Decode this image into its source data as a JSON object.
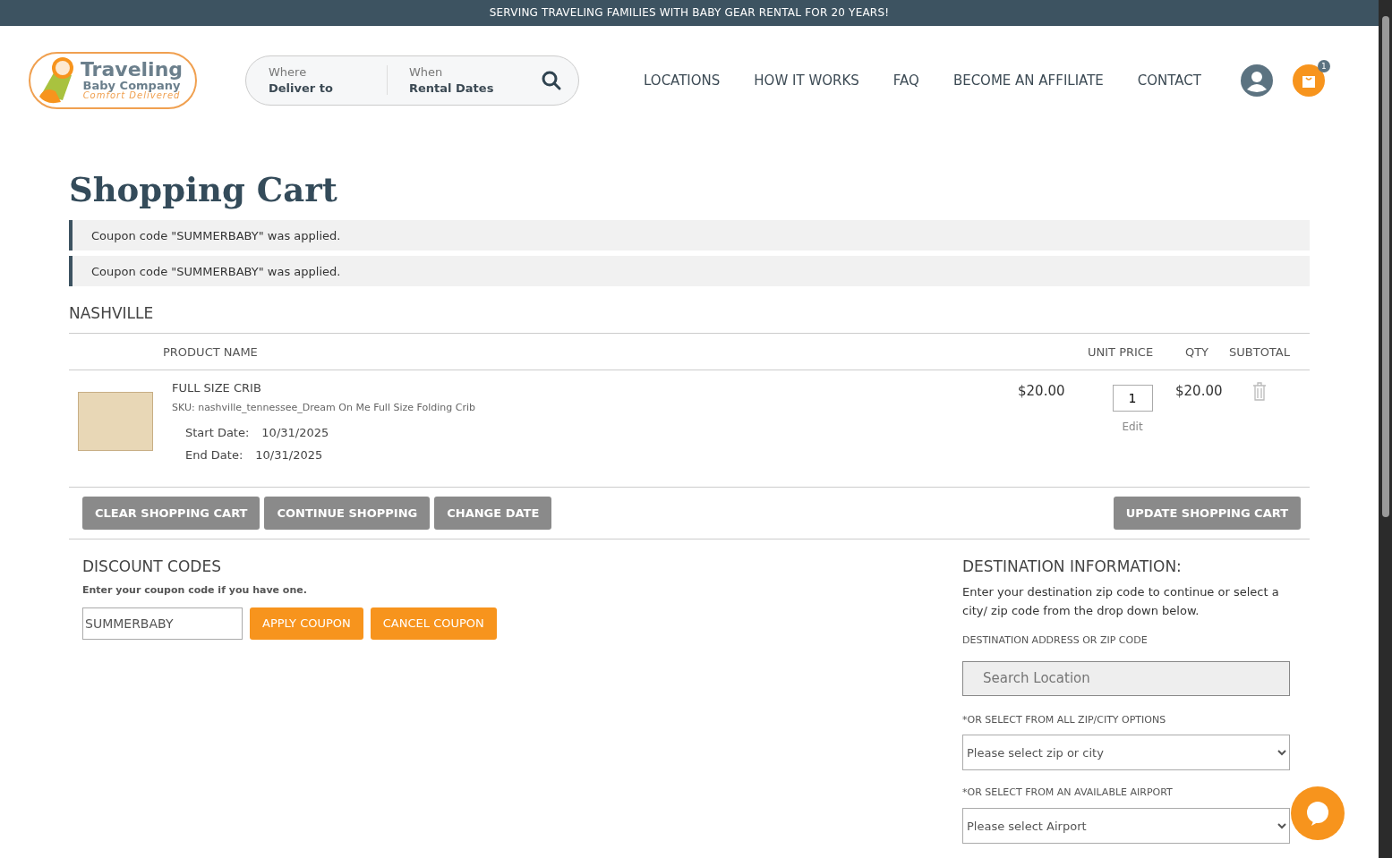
{
  "banner": "SERVING TRAVELING FAMILIES WITH BABY GEAR RENTAL FOR 20 YEARS!",
  "logo": {
    "title": "Traveling",
    "subtitle": "Baby Company",
    "tagline": "Comfort Delivered"
  },
  "search": [
    {
      "label": "Where",
      "value": "Deliver to"
    },
    {
      "label": "When",
      "value": "Rental Dates"
    }
  ],
  "nav": [
    "LOCATIONS",
    "HOW IT WORKS",
    "FAQ",
    "BECOME AN AFFILIATE",
    "CONTACT"
  ],
  "cart_count": "1",
  "page_title": "Shopping Cart",
  "messages": [
    "Coupon code \"SUMMERBABY\" was applied.",
    "Coupon code \"SUMMERBABY\" was applied."
  ],
  "location": "NASHVILLE",
  "table": {
    "columns": [
      "PRODUCT NAME",
      "UNIT PRICE",
      "QTY",
      "SUBTOTAL"
    ],
    "rows": [
      {
        "name": "FULL SIZE CRIB",
        "sku": "SKU: nashville_tennessee_Dream On Me Full Size Folding Crib",
        "start_label": "Start Date:",
        "start": "10/31/2025",
        "end_label": "End Date:",
        "end": "10/31/2025",
        "price": "$20.00",
        "qty": "1",
        "edit": "Edit",
        "subtotal": "$20.00"
      }
    ]
  },
  "cart_buttons": [
    "CLEAR SHOPPING CART",
    "CONTINUE SHOPPING",
    "CHANGE DATE"
  ],
  "update_button": "UPDATE SHOPPING CART",
  "discount": {
    "title": "DISCOUNT CODES",
    "hint": "Enter your coupon code if you have one.",
    "value": "SUMMERBABY",
    "buttons": [
      "APPLY COUPON",
      "CANCEL COUPON"
    ]
  },
  "destination": {
    "title": "DESTINATION INFORMATION:",
    "text": "Enter your destination zip code to continue or select a city/ zip code from the drop down below.",
    "address_label": "DESTINATION ADDRESS OR ZIP CODE",
    "search_placeholder": "Search Location",
    "zip_label": "*OR SELECT FROM ALL ZIP/CITY OPTIONS",
    "zip_value": "Please select zip or city",
    "airport_label": "*OR SELECT FROM AN AVAILABLE AIRPORT",
    "airport_value": "Please select Airport"
  }
}
